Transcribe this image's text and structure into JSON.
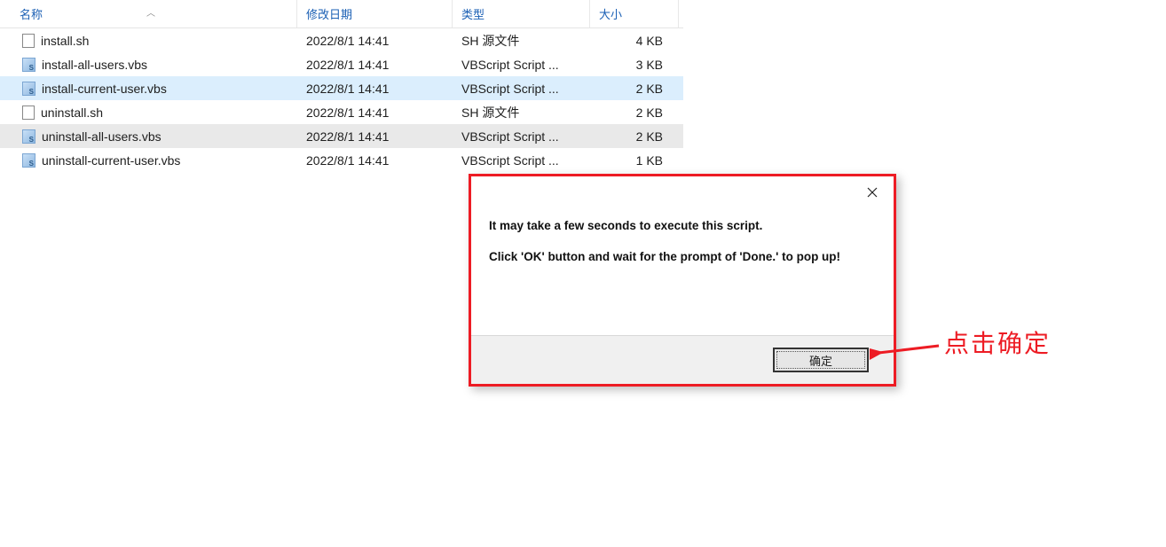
{
  "headers": {
    "name": "名称",
    "date": "修改日期",
    "type": "类型",
    "size": "大小"
  },
  "files": [
    {
      "name": "install.sh",
      "date": "2022/8/1 14:41",
      "type": "SH 源文件",
      "size": "4 KB",
      "icon": "sh",
      "state": ""
    },
    {
      "name": "install-all-users.vbs",
      "date": "2022/8/1 14:41",
      "type": "VBScript Script ...",
      "size": "3 KB",
      "icon": "vbs",
      "state": ""
    },
    {
      "name": "install-current-user.vbs",
      "date": "2022/8/1 14:41",
      "type": "VBScript Script ...",
      "size": "2 KB",
      "icon": "vbs",
      "state": "selected"
    },
    {
      "name": "uninstall.sh",
      "date": "2022/8/1 14:41",
      "type": "SH 源文件",
      "size": "2 KB",
      "icon": "sh",
      "state": ""
    },
    {
      "name": "uninstall-all-users.vbs",
      "date": "2022/8/1 14:41",
      "type": "VBScript Script ...",
      "size": "2 KB",
      "icon": "vbs",
      "state": "hover"
    },
    {
      "name": "uninstall-current-user.vbs",
      "date": "2022/8/1 14:41",
      "type": "VBScript Script ...",
      "size": "1 KB",
      "icon": "vbs",
      "state": ""
    }
  ],
  "dialog": {
    "line1": "It may take a few seconds to execute this script.",
    "line2": "Click 'OK' button and wait for the prompt of 'Done.' to pop up!",
    "ok": "确定"
  },
  "annotation": "点击确定"
}
